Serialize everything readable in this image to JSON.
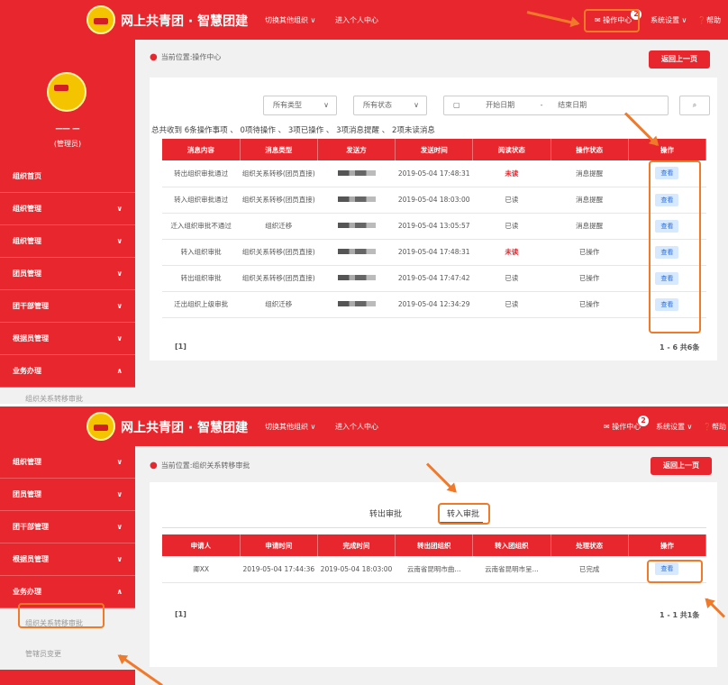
{
  "header": {
    "app_title": "网上共青团 · 智慧团建",
    "nav_switch_org": "切换其他组织",
    "nav_personal": "进入个人中心",
    "nav_ops_center": "操作中心",
    "ops_badge": "2",
    "nav_settings": "系统设置",
    "nav_help": "帮助"
  },
  "shot1": {
    "user_name": "一一 一",
    "user_role": "(管理员)",
    "sidebar": [
      {
        "label": "组织首页",
        "chevron": ""
      },
      {
        "label": "组织管理",
        "chevron": "∨"
      },
      {
        "label": "组织管理",
        "chevron": "∨"
      },
      {
        "label": "团员管理",
        "chevron": "∨"
      },
      {
        "label": "团干部管理",
        "chevron": "∨"
      },
      {
        "label": "根据员管理",
        "chevron": "∨"
      },
      {
        "label": "业务办理",
        "chevron": "∧"
      }
    ],
    "sidebar_sub": "组织关系转移审批",
    "breadcrumb": "当前位置:操作中心",
    "back_button": "返回上一页",
    "filters": {
      "type": "所有类型",
      "status": "所有状态",
      "start_date": "开始日期",
      "separator": "-",
      "end_date": "结束日期"
    },
    "summary": "总共收到 6条操作事项 、 0项待操作 、 3项已操作 、 3项消息提醒 、 2项未读消息",
    "columns": [
      "消息内容",
      "消息类型",
      "发送方",
      "发送时间",
      "阅读状态",
      "操作状态",
      "操作"
    ],
    "rows": [
      {
        "content": "转出组织审批通过",
        "type": "组织关系转移(团员直接)",
        "time": "2019-05-04 17:48:31",
        "read": "未读",
        "op_status": "消息提醒",
        "action": "查看"
      },
      {
        "content": "转入组织审批通过",
        "type": "组织关系转移(团员直接)",
        "time": "2019-05-04 18:03:00",
        "read": "已读",
        "op_status": "消息提醒",
        "action": "查看"
      },
      {
        "content": "迁入组织审批不通过",
        "type": "组织迁移",
        "time": "2019-05-04 13:05:57",
        "read": "已读",
        "op_status": "消息提醒",
        "action": "查看"
      },
      {
        "content": "转入组织审批",
        "type": "组织关系转移(团员直接)",
        "time": "2019-05-04 17:48:31",
        "read": "未读",
        "op_status": "已操作",
        "action": "查看"
      },
      {
        "content": "转出组织审批",
        "type": "组织关系转移(团员直接)",
        "time": "2019-05-04 17:47:42",
        "read": "已读",
        "op_status": "已操作",
        "action": "查看"
      },
      {
        "content": "迁出组织上级审批",
        "type": "组织迁移",
        "time": "2019-05-04 12:34:29",
        "read": "已读",
        "op_status": "已操作",
        "action": "查看"
      }
    ],
    "pager_page": "[1]",
    "pager_total": "1 - 6 共6条"
  },
  "shot2": {
    "sidebar": [
      {
        "label": "组织管理",
        "chevron": "∨"
      },
      {
        "label": "团员管理",
        "chevron": "∨"
      },
      {
        "label": "团干部管理",
        "chevron": "∨"
      },
      {
        "label": "根据员管理",
        "chevron": "∨"
      },
      {
        "label": "业务办理",
        "chevron": "∧"
      }
    ],
    "sidebar_sub_active": "组织关系转移审批",
    "sidebar_sub_next": "管辖员变更",
    "breadcrumb": "当前位置:组织关系转移审批",
    "back_button": "返回上一页",
    "tabs": {
      "out": "转出审批",
      "in": "转入审批"
    },
    "columns": [
      "申请人",
      "申请时间",
      "完成时间",
      "转出团组织",
      "转入团组织",
      "处理状态",
      "操作"
    ],
    "rows": [
      {
        "applicant": "卿XX",
        "apply_time": "2019-05-04 17:44:36",
        "finish_time": "2019-05-04 18:03:00",
        "from_org": "云南省昆明市曲...",
        "to_org": "云南省昆明市呈...",
        "status": "已完成",
        "action": "查看"
      }
    ],
    "pager_page": "[1]",
    "pager_total": "1 - 1 共1条"
  },
  "colors": {
    "brand_red": "#e8262d",
    "annotation_orange": "#f07a2a",
    "view_button_bg": "#d7e9ff"
  }
}
